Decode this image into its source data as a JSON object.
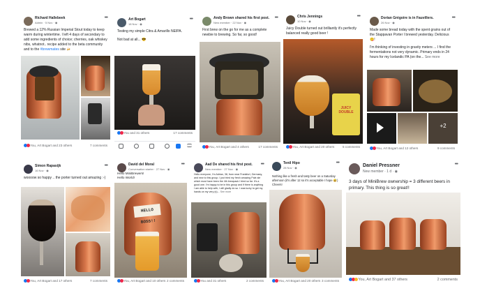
{
  "posts": [
    {
      "name": "Richard Hallebeek",
      "meta": "Admin · 5 Nov · ",
      "text": "Brewed a 12% Russian Imperial Stout today to keep warm during wintertime. I left 4 days of secondary to add some ingredients of choice; cherries, oak whiskey nibs, whatnot.. recipe added to the beta community and to the ",
      "link": "#brewmates",
      "text_after": " site 🍻",
      "reactions": "You, Art Bogart and 23 others",
      "comments": "7 comments"
    },
    {
      "name": "Art Bogart",
      "meta": "18 Nov · ",
      "text": "Testing my simple Citra & Amarillo NEIPA.",
      "text2": "Not bad at all... 😎",
      "reactions": "You and 31 others",
      "comments": "17 comments"
    },
    {
      "name": "Andy Brown shared his first post.",
      "meta": "New member · 22 Nov · ",
      "text": "First brew on the go for me as a complete newbie to brewing. So far, so good!",
      "reactions": "You, Art Bogart and 4 others",
      "comments": "17 comments"
    },
    {
      "name": "Chris Jennings",
      "meta": "10 Nov · ",
      "text": "Juicy Double turned out brilliantly it's perfectly balanced really good beer !",
      "label": "JUICY DOUBLE",
      "reactions": "You, Art Bogart and 20 others",
      "comments": "5 comments"
    },
    {
      "name": "Dorian Grégoire is in Fauvillers.",
      "meta": "26 Nov · ",
      "text": "Made some bread today with the spent grains out of the Stappavan Porter I brewed yesterday. Delicious 😋!",
      "text2": "I'm thinking of investing in gravity meters ... I find the fermentations not very dynamic. Primary ends in 24 hours for my Icelandic PA (on the...",
      "see_more": "See more",
      "more_count": "+2",
      "reactions": "You, Art Bogart and 12 others",
      "comments": "9 comments"
    },
    {
      "name": "Simon Rapasijk",
      "meta": "16 Nov · ",
      "text": "woooow so happy .. the porter turned out amazing :-)",
      "reactions": "You, Art Bogart and 17 others",
      "comments": "7 comments"
    },
    {
      "name": "David del Moral",
      "meta": "Conversation starter · 27 Nov · ",
      "text": "Hello MiniBrewers!",
      "text2": "Hello World!",
      "sign": "HELLO BOSS!!",
      "reactions": "You, Art Bogart and 10 others",
      "comments": "2 comments"
    },
    {
      "name": "Aad De shared his first post.",
      "meta": "New member · 27 Nov · ",
      "text": "Hello everyone, I'm Adrian, 38, from near Frankfurt, Germany, and new to this group. I just tried my fresh amazing Pale ale which must have been the 4th brewpack I tried so far. It's a good one. I'm happy to be in this group and if there is anything I am able to help with, I will gladly do so. I was lucky to get my hands on my very (s)...",
      "see_more": "See more",
      "reactions": "You and 31 others",
      "comments": "2 comments"
    },
    {
      "name": "Tenil Hipo",
      "meta": "28 Nov · ",
      "text": "Nothing like a fresh and tasty beer on a Saturday afternoon (it's after 12 so it's acceptable I hope 😅) Cheers!",
      "reactions": "You, Art Bogart and 20 others",
      "comments": "3 comments"
    },
    {
      "name": "Daniel Pressner",
      "meta": "New member · 1 d · ",
      "text": "3 days of MiniBrew ownership = 3 different beers in primary. This thing is so great!!",
      "reactions": "You, Art Bogart and 37 others",
      "comments": "2 comments"
    }
  ],
  "nav": {
    "label": "nav"
  },
  "colors": {
    "accent": "#1877f2",
    "keg": "#d7764a",
    "beer": "#e0a040"
  }
}
